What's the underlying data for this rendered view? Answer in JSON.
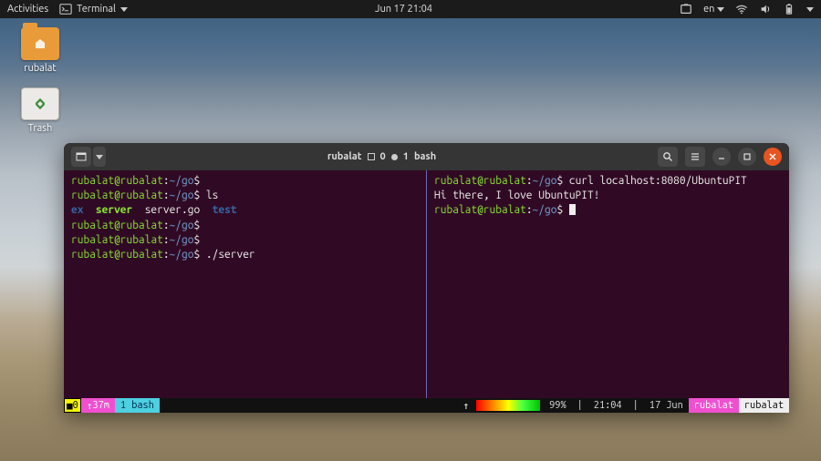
{
  "topbar": {
    "activities": "Activities",
    "app_name": "Terminal",
    "datetime": "Jun 17  21:04",
    "lang": "en"
  },
  "desktop": {
    "home_label": "rubalat",
    "trash_label": "Trash"
  },
  "window": {
    "title_prefix": "rubalat",
    "pane_count": "0",
    "session_index": "1",
    "session_name": "bash"
  },
  "left_pane": {
    "lines": [
      {
        "user": "rubalat@rubalat",
        "path": "~/go",
        "cmd": ""
      },
      {
        "user": "rubalat@rubalat",
        "path": "~/go",
        "cmd": "ls"
      }
    ],
    "ls_output": {
      "ex": "ex",
      "server": "server",
      "servergo": "server.go",
      "test": "test"
    },
    "after": [
      {
        "user": "rubalat@rubalat",
        "path": "~/go",
        "cmd": ""
      },
      {
        "user": "rubalat@rubalat",
        "path": "~/go",
        "cmd": ""
      },
      {
        "user": "rubalat@rubalat",
        "path": "~/go",
        "cmd": "./server"
      }
    ]
  },
  "right_pane": {
    "line1": {
      "user": "rubalat@rubalat",
      "path": "~/go",
      "cmd": "curl localhost:8080/UbuntuPIT"
    },
    "output": "Hi there, I love UbuntuPIT!",
    "line2": {
      "user": "rubalat@rubalat",
      "path": "~/go"
    }
  },
  "status": {
    "left_index": "0",
    "uptime": "37m",
    "win": "1 bash",
    "battery": "99%",
    "time": "21:04",
    "date": "17 Jun",
    "user": "rubalat",
    "host": "rubalat"
  }
}
